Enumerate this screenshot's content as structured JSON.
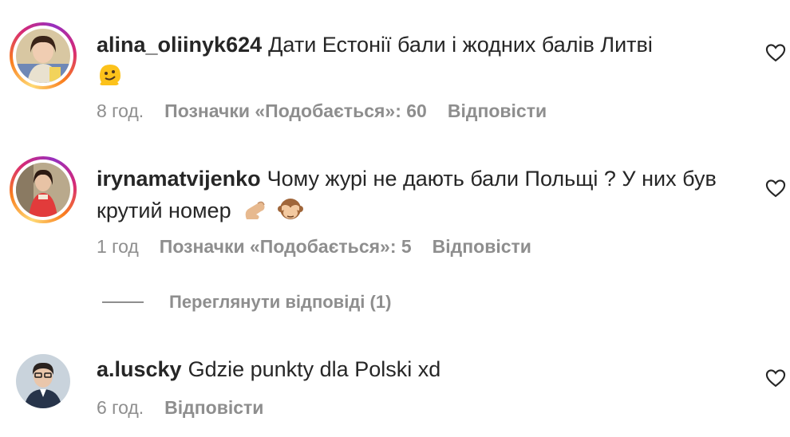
{
  "comments": [
    {
      "username": "alina_oliinyk624",
      "text": "Дати Естонії бали і жодних балів Литві",
      "emoji_icons": [
        "melting-face-emoji"
      ],
      "time": "8 год.",
      "likes": "Позначки «Подобається»: 60",
      "reply": "Відповісти",
      "story_ring": true
    },
    {
      "username": "irynamatvijenko",
      "text": "Чому журі не дають бали Польщі ? У них був крутий номер",
      "emoji_icons": [
        "pinching-hand-emoji",
        "see-no-evil-monkey-emoji"
      ],
      "time": "1 год",
      "likes": "Позначки «Подобається»: 5",
      "reply": "Відповісти",
      "story_ring": true
    },
    {
      "username": "a.luscky",
      "text": "Gdzie punkty dla Polski xd",
      "emoji_icons": [],
      "time": "6 год.",
      "likes": "",
      "reply": "Відповісти",
      "story_ring": false
    }
  ],
  "view_replies": "Переглянути відповіді (1)",
  "icons": {
    "like": "heart-outline-icon"
  },
  "colors": {
    "text": "#262626",
    "meta": "#8e8e8e",
    "ring_start": "#feda75",
    "ring_end": "#962fbf"
  }
}
